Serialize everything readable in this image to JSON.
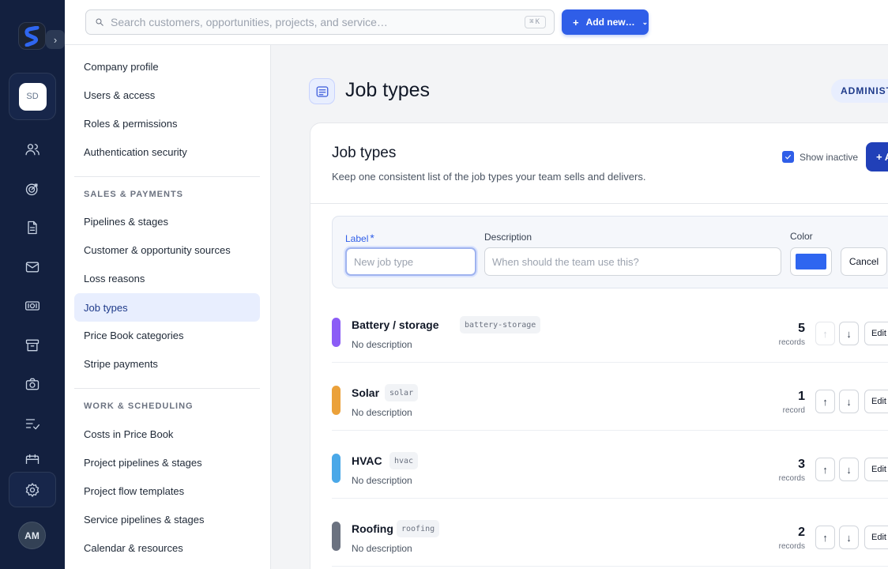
{
  "rail": {
    "workspace_initials": "SD",
    "user_initials": "AM",
    "toggle_glyph": "›",
    "icons": [
      "users-icon",
      "target-icon",
      "document-icon",
      "mail-icon",
      "money-icon",
      "archive-icon",
      "camera-icon",
      "checklist-icon",
      "calendar-icon",
      "gear-icon"
    ]
  },
  "topbar": {
    "search_placeholder": "Search customers, opportunities, projects, and service…",
    "search_shortcut": "⌘K",
    "add_new_label": "Add new…",
    "add_new_plus": "+",
    "add_new_chevron": "⌄"
  },
  "nav": {
    "items_top": [
      "Company profile",
      "Users & access",
      "Roles & permissions",
      "Authentication security"
    ],
    "section_sales": "SALES & PAYMENTS",
    "items_sales": [
      "Pipelines & stages",
      "Customer & opportunity sources",
      "Loss reasons",
      "Job types",
      "Price Book categories",
      "Stripe payments"
    ],
    "section_work": "WORK & SCHEDULING",
    "items_work": [
      "Costs in Price Book",
      "Project pipelines & stages",
      "Project flow templates",
      "Service pipelines & stages",
      "Calendar & resources"
    ],
    "active": "Job types"
  },
  "page": {
    "title": "Job types",
    "badge": "ADMINIST"
  },
  "card": {
    "title": "Job types",
    "description": "Keep one consistent list of the job types your team sells and delivers.",
    "show_inactive_label": "Show inactive",
    "show_inactive_checked": true,
    "add_button_label": "+ A"
  },
  "form": {
    "label_label": "Label",
    "label_required": "*",
    "label_placeholder": "New job type",
    "description_label": "Description",
    "description_placeholder": "When should the team use this?",
    "color_label": "Color",
    "color_value": "#2f66f0",
    "cancel_label": "Cancel"
  },
  "job_types": [
    {
      "name": "Battery / storage",
      "slug": "battery-storage",
      "description": "No description",
      "count": "5",
      "unit": "records",
      "color": "#8b5cf6",
      "up_disabled": true,
      "up": "↑",
      "down": "↓",
      "edit": "Edit"
    },
    {
      "name": "Solar",
      "slug": "solar",
      "description": "No description",
      "count": "1",
      "unit": "record",
      "color": "#eba13a",
      "up_disabled": false,
      "up": "↑",
      "down": "↓",
      "edit": "Edit"
    },
    {
      "name": "HVAC",
      "slug": "hvac",
      "description": "No description",
      "count": "3",
      "unit": "records",
      "color": "#4aa8e8",
      "up_disabled": false,
      "up": "↑",
      "down": "↓",
      "edit": "Edit"
    },
    {
      "name": "Roofing",
      "slug": "roofing",
      "description": "No description",
      "count": "2",
      "unit": "records",
      "color": "#6b7280",
      "up_disabled": false,
      "up": "↑",
      "down": "↓",
      "edit": "Edit"
    }
  ]
}
